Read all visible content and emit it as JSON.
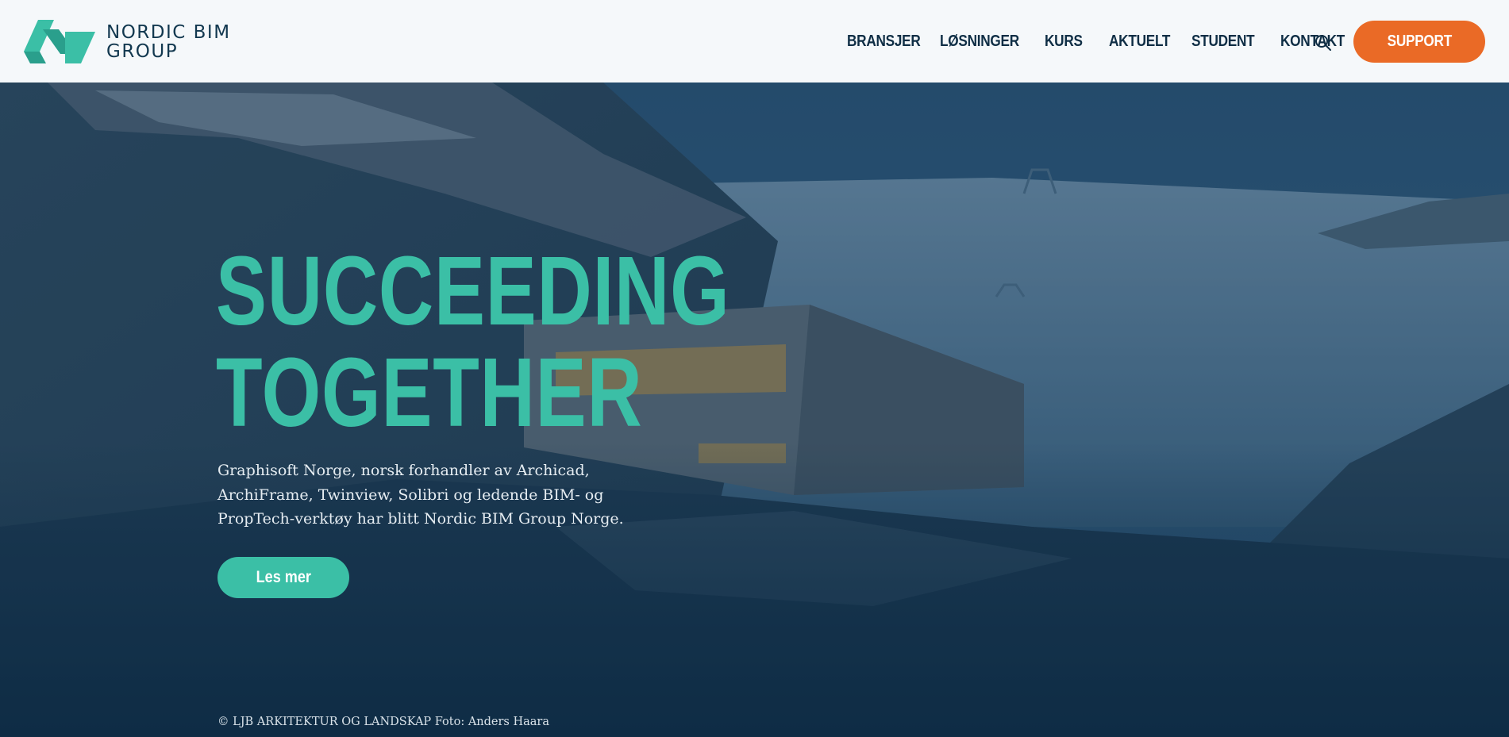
{
  "brand": {
    "name_line1": "NORDIC BIM",
    "name_line2": "GROUP",
    "primary_color": "#3bbfa6",
    "dark_color": "#12384f",
    "accent_color": "#ea6a26"
  },
  "nav": {
    "items": [
      {
        "label": "BRANSJER"
      },
      {
        "label": "LØSNINGER"
      },
      {
        "label": "KURS"
      },
      {
        "label": "AKTUELT"
      },
      {
        "label": "STUDENT"
      },
      {
        "label": "KONTAKT"
      }
    ],
    "search_icon": "search-icon",
    "support_label": "SUPPORT"
  },
  "hero": {
    "headline_line1": "SUCCEEDING",
    "headline_line2": "TOGETHER",
    "intro": "Graphisoft Norge, norsk forhandler av Archicad, ArchiFrame, Twinview, Solibri og ledende BIM- og PropTech-verktøy har blitt Nordic BIM Group Norge.",
    "cta_label": "Les mer",
    "photo_credit": "© LJB ARKITEKTUR OG LANDSKAP Foto: Anders Haara"
  }
}
